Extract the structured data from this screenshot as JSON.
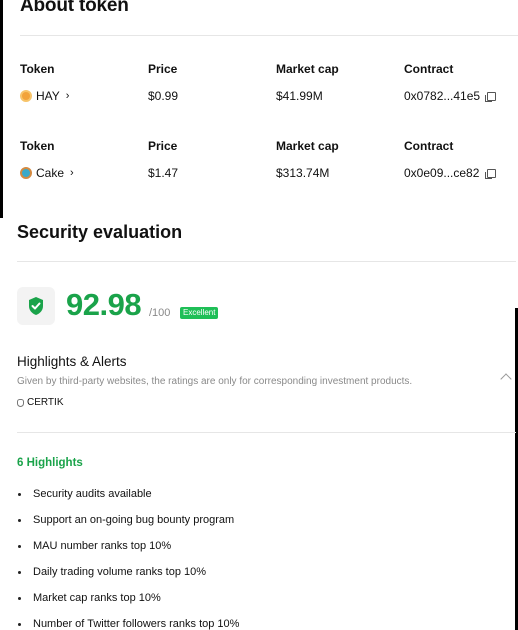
{
  "about": {
    "title": "About token",
    "tokens": [
      {
        "headers": {
          "token": "Token",
          "price": "Price",
          "market_cap": "Market cap",
          "contract": "Contract"
        },
        "name": "HAY",
        "price": "$0.99",
        "market_cap": "$41.99M",
        "contract": "0x0782...41e5",
        "icon": "hay-coin-icon"
      },
      {
        "headers": {
          "token": "Token",
          "price": "Price",
          "market_cap": "Market cap",
          "contract": "Contract"
        },
        "name": "Cake",
        "price": "$1.47",
        "market_cap": "$313.74M",
        "contract": "0x0e09...ce82",
        "icon": "cake-coin-icon"
      }
    ]
  },
  "security": {
    "title": "Security evaluation",
    "score": "92.98",
    "score_max": "/100",
    "rating": "Excellent",
    "accent_color": "#1aa34a",
    "highlights_title": "Highlights & Alerts",
    "highlights_subtitle": "Given by third-party websites, the ratings are only for corresponding investment products.",
    "provider": "CERTIK",
    "highlights_count": "6 Highlights",
    "highlights": [
      "Security audits available",
      "Support an on-going bug bounty program",
      "MAU number ranks top 10%",
      "Daily trading volume ranks top 10%",
      "Market cap ranks top 10%",
      "Number of Twitter followers ranks top 10%"
    ]
  }
}
